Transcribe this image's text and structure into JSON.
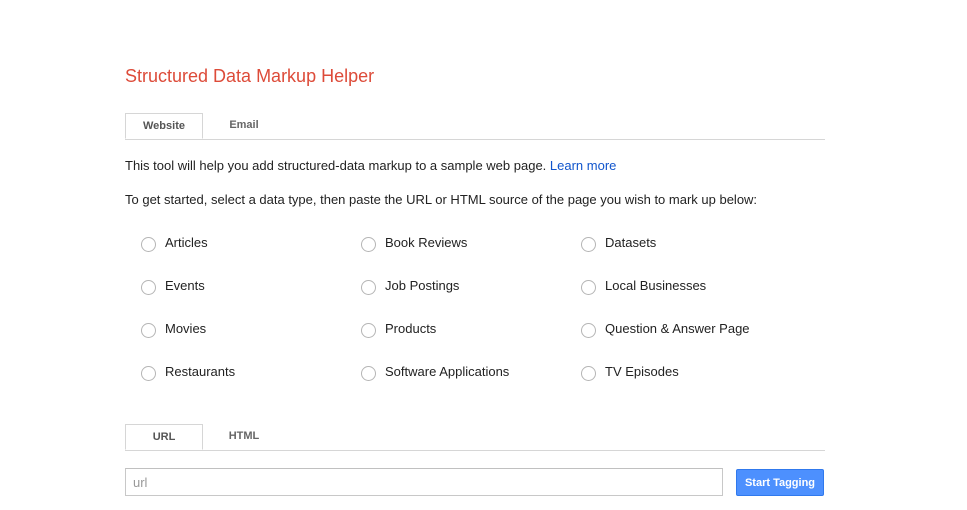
{
  "title": "Structured Data Markup Helper",
  "source_tabs": [
    {
      "label": "Website",
      "active": true
    },
    {
      "label": "Email",
      "active": false
    }
  ],
  "intro": {
    "text": "This tool will help you add structured-data markup to a sample web page.",
    "link": "Learn more"
  },
  "instruction": "To get started, select a data type, then paste the URL or HTML source of the page you wish to mark up below:",
  "data_types": [
    "Articles",
    "Book Reviews",
    "Datasets",
    "Events",
    "Job Postings",
    "Local Businesses",
    "Movies",
    "Products",
    "Question & Answer Page",
    "Restaurants",
    "Software Applications",
    "TV Episodes"
  ],
  "input_tabs": [
    {
      "label": "URL",
      "active": true
    },
    {
      "label": "HTML",
      "active": false
    }
  ],
  "url_input": {
    "value": "",
    "placeholder": "url"
  },
  "start_button": "Start Tagging",
  "colors": {
    "title": "#dd4b39",
    "link": "#1155cc",
    "button": "#4d90fe"
  }
}
